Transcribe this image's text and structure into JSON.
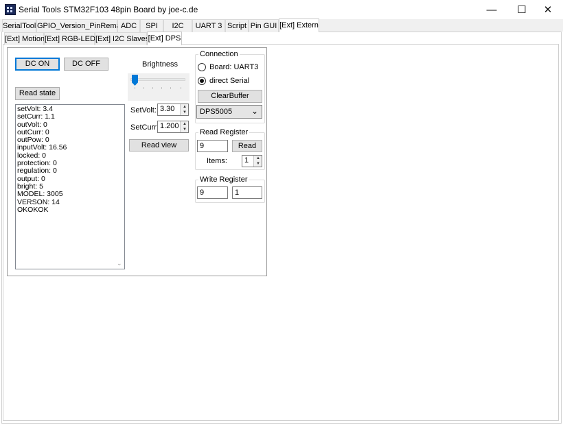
{
  "window": {
    "title": "Serial Tools STM32F103 48pin Board by joe-c.de",
    "controls": {
      "minimize": "—",
      "maximize": "☐",
      "close": "✕"
    }
  },
  "main_tabs": [
    "SerialTool",
    "GPIO_Version_PinRemap",
    "ADC",
    "SPI",
    "I2C",
    "UART 3",
    "Script",
    "Pin GUI",
    "[Ext] Extern"
  ],
  "main_tab_selected": "[Ext] Extern",
  "sub_tabs": [
    "[Ext] Motion",
    "[Ext] RGB-LED",
    "[Ext] I2C Slaves",
    "[Ext] DPS"
  ],
  "sub_tab_selected": "[Ext] DPS",
  "dps": {
    "dc_on": "DC ON",
    "dc_off": "DC OFF",
    "read_state": "Read state",
    "output_lines": [
      "setVolt: 3.4",
      "setCurr: 1.1",
      "outVolt: 0",
      "outCurr: 0",
      "outPow: 0",
      "inputVolt: 16.56",
      "locked: 0",
      "protection: 0",
      "regulation: 0",
      "output: 0",
      "bright: 5",
      "MODEL: 3005",
      "VERSON: 14",
      "OKOKOK"
    ],
    "brightness_label": "Brightness",
    "brightness_value": 0,
    "set_volt_label": "SetVolt:",
    "set_volt_value": "3.30",
    "set_curr_label": "SetCurr:",
    "set_curr_value": "1.200",
    "read_view": "Read view"
  },
  "connection": {
    "title": "Connection",
    "option_board": "Board: UART3",
    "option_direct": "direct Serial",
    "selected": "direct Serial",
    "clear_buffer": "ClearBuffer",
    "device": "DPS5005"
  },
  "read_register": {
    "title": "Read Register",
    "address": "9",
    "read_button": "Read",
    "items_label": "Items:",
    "items_value": "1"
  },
  "write_register": {
    "title": "Write Register",
    "address": "9",
    "value": "1"
  },
  "colors": {
    "accent": "#0078d7",
    "button_bg": "#e1e1e1",
    "tab_bg": "#f0f0f0"
  }
}
